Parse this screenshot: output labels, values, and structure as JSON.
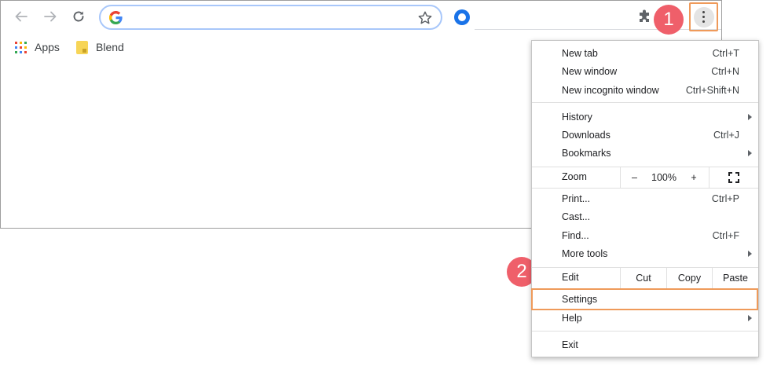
{
  "omnibox": {
    "value": "",
    "placeholder": ""
  },
  "bookmarks": [
    {
      "label": "Apps",
      "icon": "apps-grid-icon"
    },
    {
      "label": "Blend",
      "icon": "bookmark-folder-icon"
    }
  ],
  "badges": {
    "step1": "1",
    "step2": "2"
  },
  "menu": {
    "new_tab": {
      "label": "New tab",
      "shortcut": "Ctrl+T"
    },
    "new_window": {
      "label": "New window",
      "shortcut": "Ctrl+N"
    },
    "new_incognito": {
      "label": "New incognito window",
      "shortcut": "Ctrl+Shift+N"
    },
    "history": {
      "label": "History"
    },
    "downloads": {
      "label": "Downloads",
      "shortcut": "Ctrl+J"
    },
    "bookmarks": {
      "label": "Bookmarks"
    },
    "zoom": {
      "label": "Zoom",
      "minus": "–",
      "value": "100%",
      "plus": "+"
    },
    "print": {
      "label": "Print...",
      "shortcut": "Ctrl+P"
    },
    "cast": {
      "label": "Cast..."
    },
    "find": {
      "label": "Find...",
      "shortcut": "Ctrl+F"
    },
    "more_tools": {
      "label": "More tools"
    },
    "edit": {
      "label": "Edit",
      "cut": "Cut",
      "copy": "Copy",
      "paste": "Paste"
    },
    "settings": {
      "label": "Settings"
    },
    "help": {
      "label": "Help"
    },
    "exit": {
      "label": "Exit"
    }
  },
  "colors": {
    "accent_highlight": "#ef9a5a",
    "badge": "#ef5f6a",
    "omnibox_focus": "#a8c7fa"
  }
}
